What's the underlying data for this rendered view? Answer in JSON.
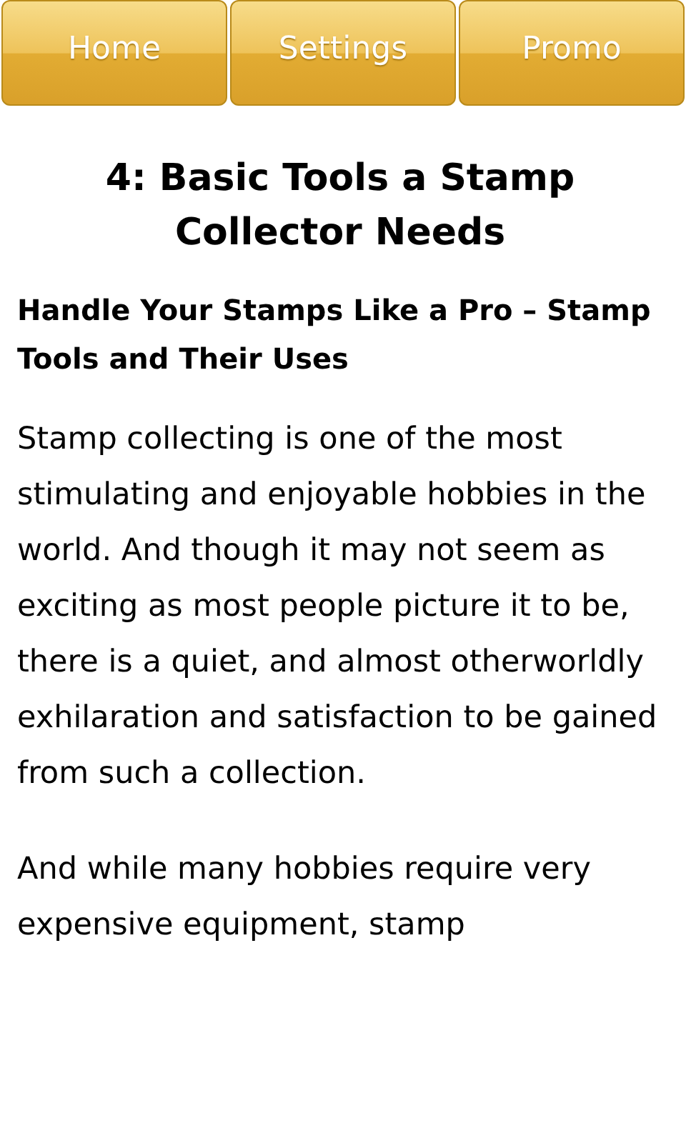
{
  "nav": [
    {
      "label": "Home"
    },
    {
      "label": "Settings"
    },
    {
      "label": "Promo"
    }
  ],
  "article": {
    "title": "4: Basic Tools a Stamp Collector Needs",
    "subtitle": "Handle Your Stamps Like a Pro – Stamp Tools and Their Uses",
    "paragraphs": [
      "Stamp collecting is one of the most stimulating and enjoyable hobbies in the world. And though it may not seem as exciting as most people picture it to be, there is a quiet, and almost otherworldly exhilaration and satisfaction to be gained from such a collection.",
      "And while many hobbies require very expensive equipment, stamp"
    ]
  }
}
